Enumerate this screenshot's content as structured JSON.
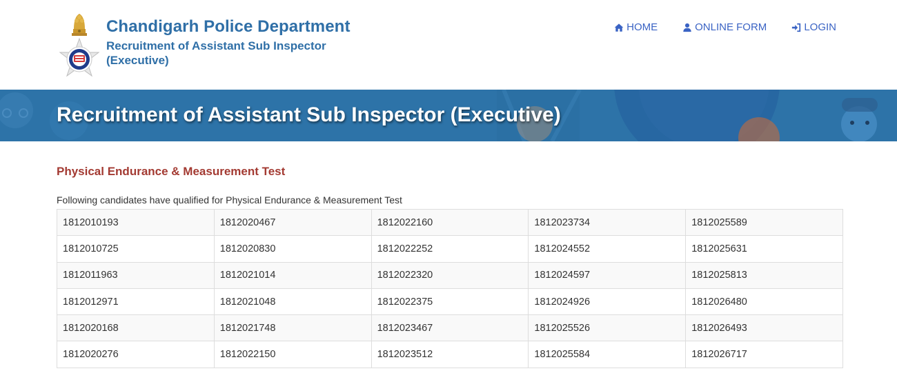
{
  "header": {
    "title": "Chandigarh Police Department",
    "subtitle_line1": "Recruitment of Assistant Sub Inspector",
    "subtitle_line2": "(Executive)",
    "logo_icon": "police-emblem-icon"
  },
  "nav": {
    "items": [
      {
        "label": "HOME",
        "icon": "home-icon"
      },
      {
        "label": "ONLINE FORM",
        "icon": "user-icon"
      },
      {
        "label": "LOGIN",
        "icon": "sign-in-icon"
      }
    ]
  },
  "banner": {
    "title": "Recruitment of Assistant Sub Inspector (Executive)"
  },
  "main": {
    "section_title": "Physical Endurance & Measurement Test",
    "intro": "Following candidates have qualified for Physical Endurance & Measurement Test",
    "rows": [
      [
        "1812010193",
        "1812020467",
        "1812022160",
        "1812023734",
        "1812025589"
      ],
      [
        "1812010725",
        "1812020830",
        "1812022252",
        "1812024552",
        "1812025631"
      ],
      [
        "1812011963",
        "1812021014",
        "1812022320",
        "1812024597",
        "1812025813"
      ],
      [
        "1812012971",
        "1812021048",
        "1812022375",
        "1812024926",
        "1812026480"
      ],
      [
        "1812020168",
        "1812021748",
        "1812023467",
        "1812025526",
        "1812026493"
      ],
      [
        "1812020276",
        "1812022150",
        "1812023512",
        "1812025584",
        "1812026717"
      ]
    ]
  },
  "colors": {
    "brand": "#2f6fa7",
    "nav_link": "#3a63c4",
    "banner": "#2d73a8",
    "section_title": "#a33a32"
  }
}
